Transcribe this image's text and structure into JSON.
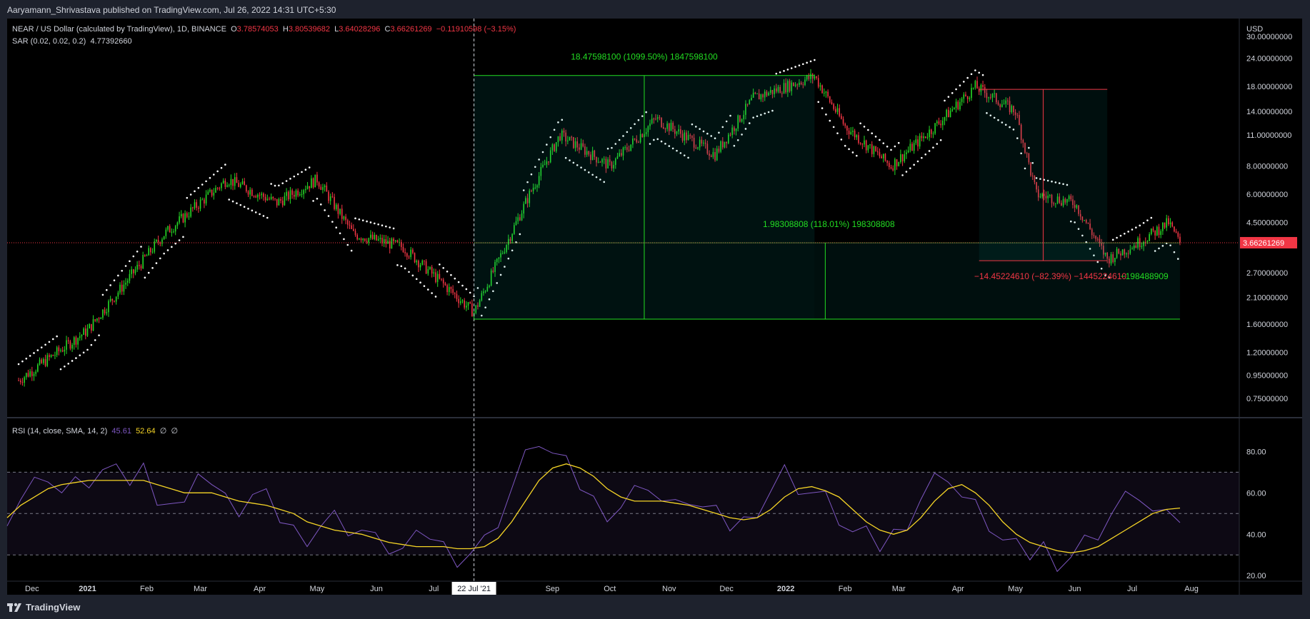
{
  "header": {
    "publisher": "Aaryamann_Shrivastava published on TradingView.com, Jul 26, 2022 14:31 UTC+5:30"
  },
  "legend": {
    "symbol": "NEAR / US Dollar (calculated by TradingView), 1D, BINANCE",
    "o_label": "O",
    "o_value": "3.78574053",
    "h_label": "H",
    "h_value": "3.80539682",
    "l_label": "L",
    "l_value": "3.64028296",
    "c_label": "C",
    "c_value": "3.66261269",
    "change": "−0.11910598 (−3.15%)",
    "sar_label": "SAR (0.02, 0.02, 0.2)",
    "sar_value": "4.77392660",
    "rsi_label": "RSI (14, close, SMA, 14, 2)",
    "rsi_value": "45.61",
    "rsi_ma_value": "52.64",
    "rsi_extra1": "∅",
    "rsi_extra2": "∅"
  },
  "footer": {
    "brand": "TradingView"
  },
  "colors": {
    "up": "#26d926",
    "down": "#f23645",
    "sar": "#ffffff",
    "rsi": "#7e57c2",
    "rsi_ma": "#f5d426",
    "measure_up": "#22dd22",
    "measure_down": "#f23645"
  },
  "chart_data": [
    {
      "type": "candlestick",
      "title": "NEAR / US Dollar",
      "y_unit": "USD",
      "y_scale": "log",
      "ylim": [
        0.62,
        36
      ],
      "y_ticks": [
        "30.00000000",
        "24.00000000",
        "18.00000000",
        "14.00000000",
        "11.00000000",
        "8.00000000",
        "6.00000000",
        "4.50000000",
        "3.66261269",
        "2.70000000",
        "2.10000000",
        "1.60000000",
        "1.20000000",
        "0.95000000",
        "0.75000000"
      ],
      "y_tick_values": [
        30,
        24,
        18,
        14,
        11,
        8,
        6,
        4.5,
        3.66261269,
        2.7,
        2.1,
        1.6,
        1.2,
        0.95,
        0.75
      ],
      "x_ticks": [
        "Dec",
        "2021",
        "Feb",
        "Mar",
        "Apr",
        "May",
        "Jun",
        "Jul",
        "22 Jul '21",
        "Sep",
        "Oct",
        "Nov",
        "Dec",
        "2022",
        "Feb",
        "Mar",
        "Apr",
        "May",
        "Jun",
        "Jul",
        "Aug"
      ],
      "last_price": 3.66261269,
      "last_price_label": "3.66261269",
      "crosshair_date": "22 Jul '21",
      "key_points": [
        {
          "date": "2020-11-26",
          "close": 0.9
        },
        {
          "date": "2021-01-01",
          "close": 1.5
        },
        {
          "date": "2021-02-10",
          "close": 4.0
        },
        {
          "date": "2021-03-15",
          "close": 7.0
        },
        {
          "date": "2021-04-10",
          "close": 5.5
        },
        {
          "date": "2021-05-01",
          "close": 7.0
        },
        {
          "date": "2021-05-20",
          "close": 4.0
        },
        {
          "date": "2021-06-15",
          "close": 3.5
        },
        {
          "date": "2021-07-22",
          "close": 1.8
        },
        {
          "date": "2021-08-20",
          "close": 6.0
        },
        {
          "date": "2021-09-05",
          "close": 11.0
        },
        {
          "date": "2021-10-01",
          "close": 8.0
        },
        {
          "date": "2021-10-25",
          "close": 13.0
        },
        {
          "date": "2021-11-25",
          "close": 9.0
        },
        {
          "date": "2021-12-15",
          "close": 16.0
        },
        {
          "date": "2022-01-16",
          "close": 20.0
        },
        {
          "date": "2022-02-01",
          "close": 12.0
        },
        {
          "date": "2022-02-25",
          "close": 8.0
        },
        {
          "date": "2022-03-20",
          "close": 12.0
        },
        {
          "date": "2022-04-10",
          "close": 18.0
        },
        {
          "date": "2022-05-01",
          "close": 14.0
        },
        {
          "date": "2022-05-12",
          "close": 6.0
        },
        {
          "date": "2022-06-01",
          "close": 5.5
        },
        {
          "date": "2022-06-18",
          "close": 3.1
        },
        {
          "date": "2022-07-05",
          "close": 3.7
        },
        {
          "date": "2022-07-20",
          "close": 4.5
        },
        {
          "date": "2022-07-26",
          "close": 3.66
        }
      ],
      "measurements": [
        {
          "label": "18.47598100 (1099.50%) 1847598100",
          "from": 1.68,
          "to": 20.15,
          "direction": "up"
        },
        {
          "label": "1.98308808 (118.01%) 198308808",
          "from": 1.68,
          "to": 3.66,
          "direction": "up"
        },
        {
          "label": "−14.45224610 (−82.39%) −1445224610",
          "from": 17.5,
          "to": 3.05,
          "direction": "down"
        },
        {
          "label": "−198488909",
          "direction": "down"
        }
      ]
    },
    {
      "type": "line",
      "title": "RSI (14, close, SMA, 14, 2)",
      "ylim": [
        18,
        96
      ],
      "y_ticks": [
        "80.00",
        "60.00",
        "40.00",
        "20.00"
      ],
      "y_tick_values": [
        80,
        60,
        40,
        20
      ],
      "bands": {
        "upper": 70,
        "middle": 50,
        "lower": 30
      },
      "series": [
        {
          "name": "RSI",
          "values": [
            44,
            58,
            64,
            70,
            60,
            63,
            66,
            70,
            68,
            66,
            72,
            60,
            56,
            52,
            74,
            64,
            55,
            52,
            58,
            56,
            48,
            42,
            40,
            45,
            48,
            44,
            42,
            36,
            34,
            32,
            36,
            40,
            34,
            30,
            32,
            36,
            48,
            62,
            76,
            86,
            78,
            72,
            64,
            56,
            52,
            54,
            60,
            66,
            56,
            52,
            58,
            52,
            48,
            44,
            46,
            54,
            62,
            70,
            64,
            60,
            56,
            48,
            40,
            38,
            34,
            40,
            48,
            58,
            66,
            70,
            58,
            52,
            45,
            36,
            32,
            30,
            34,
            28,
            30,
            36,
            42,
            50,
            56,
            60,
            50,
            46,
            45.61
          ]
        },
        {
          "name": "MA",
          "values": [
            48,
            54,
            58,
            62,
            64,
            65,
            66,
            66,
            66,
            66,
            66,
            64,
            62,
            60,
            60,
            60,
            58,
            56,
            55,
            54,
            52,
            50,
            46,
            44,
            42,
            41,
            40,
            38,
            36,
            35,
            34,
            34,
            34,
            33,
            33,
            34,
            38,
            46,
            56,
            66,
            72,
            74,
            72,
            68,
            62,
            58,
            56,
            56,
            56,
            55,
            54,
            52,
            50,
            48,
            47,
            48,
            52,
            58,
            62,
            63,
            61,
            58,
            52,
            46,
            42,
            40,
            42,
            48,
            56,
            62,
            64,
            60,
            54,
            46,
            40,
            36,
            34,
            32,
            31,
            32,
            34,
            38,
            42,
            46,
            50,
            52,
            52.64
          ]
        }
      ]
    }
  ]
}
